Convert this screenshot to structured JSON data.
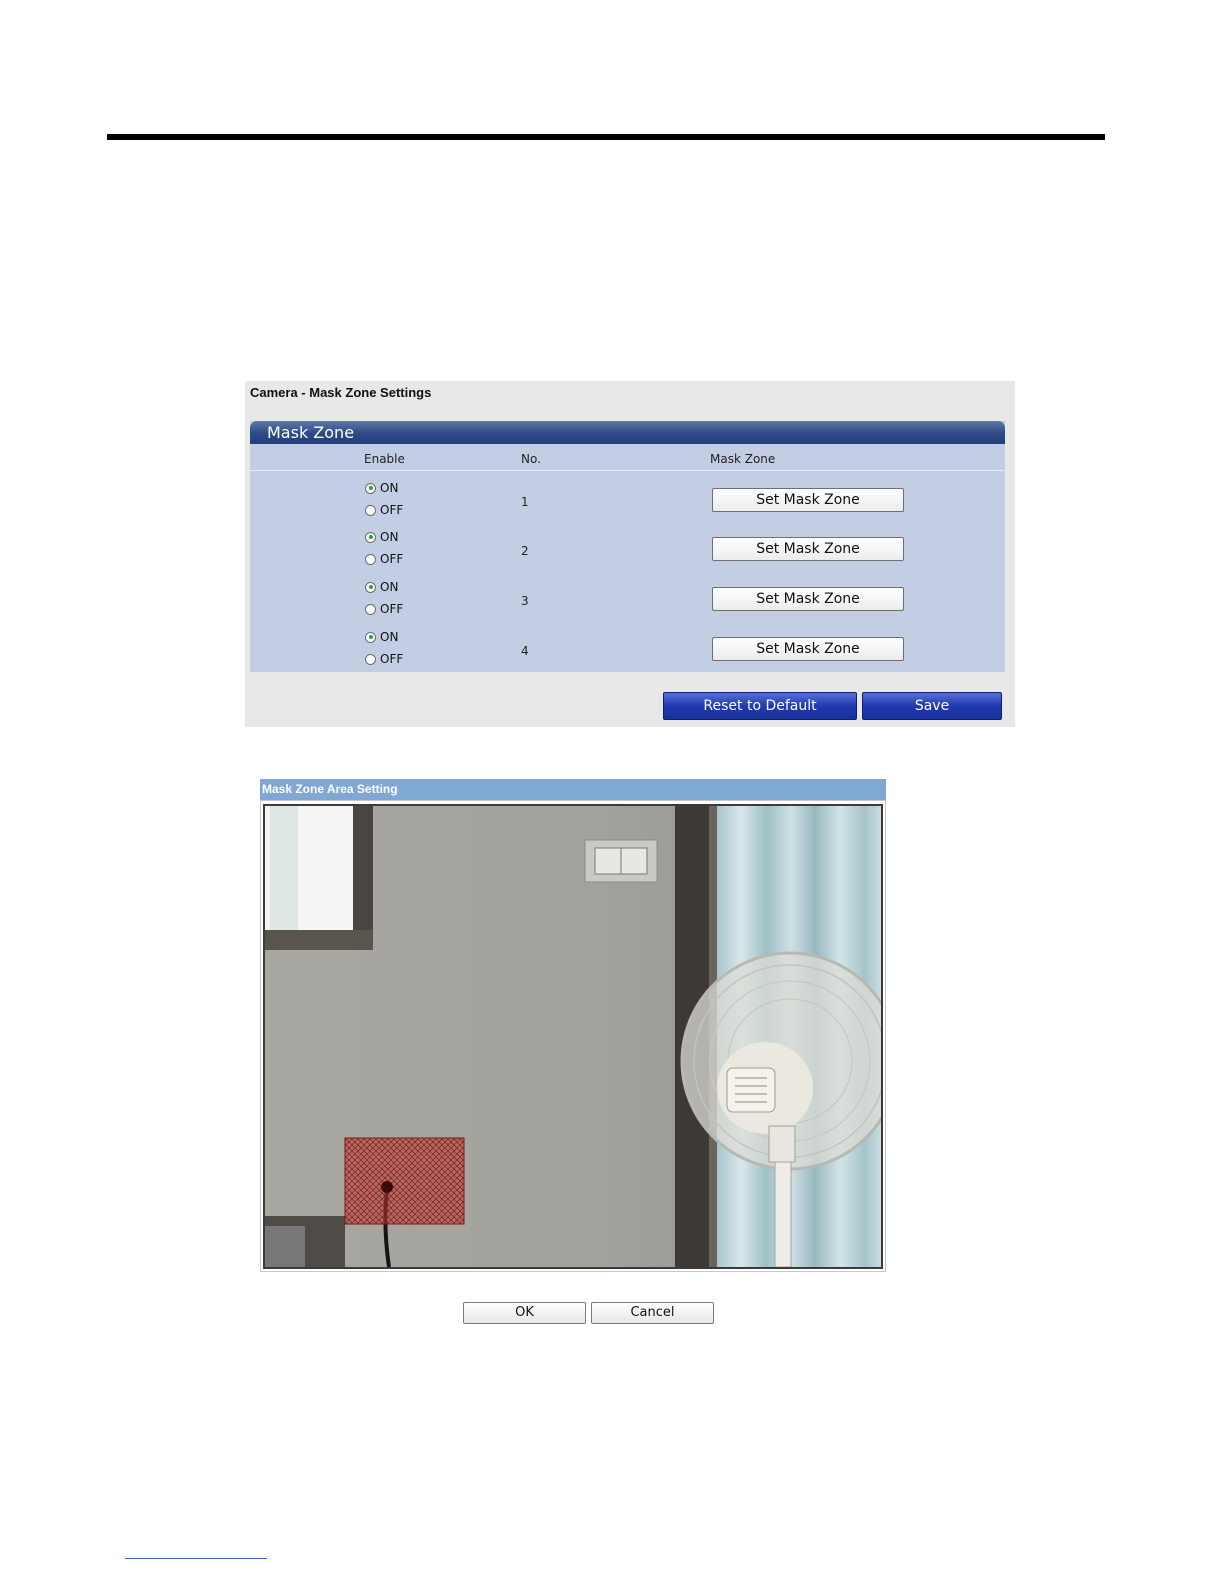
{
  "panel": {
    "title": "Camera - Mask Zone Settings",
    "section_title": "Mask Zone",
    "columns": {
      "enable": "Enable",
      "no": "No.",
      "mask_zone": "Mask Zone"
    },
    "rows": [
      {
        "no": "1",
        "on_label": "ON",
        "off_label": "OFF",
        "enabled": true,
        "button": "Set Mask Zone"
      },
      {
        "no": "2",
        "on_label": "ON",
        "off_label": "OFF",
        "enabled": true,
        "button": "Set Mask Zone"
      },
      {
        "no": "3",
        "on_label": "ON",
        "off_label": "OFF",
        "enabled": true,
        "button": "Set Mask Zone"
      },
      {
        "no": "4",
        "on_label": "ON",
        "off_label": "OFF",
        "enabled": true,
        "button": "Set Mask Zone"
      }
    ],
    "reset_label": "Reset to Default",
    "save_label": "Save"
  },
  "area_setting": {
    "title": "Mask Zone Area Setting",
    "ok_label": "OK",
    "cancel_label": "Cancel"
  },
  "colors": {
    "header_blue": "#2d4a86",
    "panel_body": "#c3cde4",
    "mask_red": "#c0392b",
    "title_bar": "#7fa8d6"
  }
}
